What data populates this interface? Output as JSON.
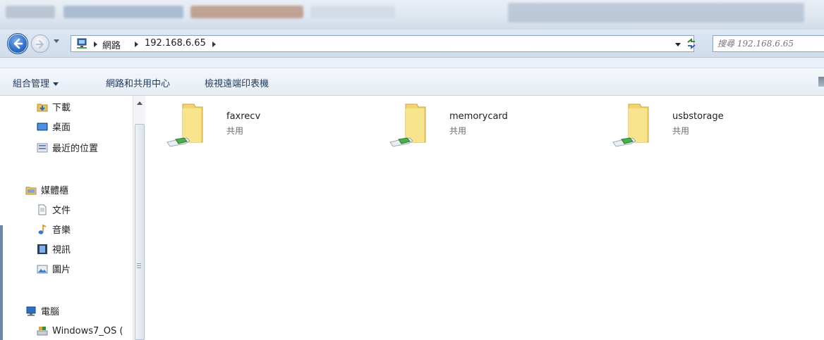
{
  "address_bar": {
    "breadcrumbs": [
      "網路",
      "192.168.6.65"
    ],
    "search_placeholder": "搜尋 192.168.6.65"
  },
  "command_bar": {
    "organize": "組合管理",
    "network_center": "網路和共用中心",
    "remote_printers": "檢視遠端印表機"
  },
  "nav_pane": {
    "items": [
      {
        "label": "下載",
        "icon": "downloads-icon"
      },
      {
        "label": "桌面",
        "icon": "desktop-icon"
      },
      {
        "label": "最近的位置",
        "icon": "recent-places-icon"
      },
      {
        "label": "媒體櫃",
        "icon": "libraries-icon",
        "group": true
      },
      {
        "label": "文件",
        "icon": "documents-icon"
      },
      {
        "label": "音樂",
        "icon": "music-icon"
      },
      {
        "label": "視訊",
        "icon": "videos-icon"
      },
      {
        "label": "圖片",
        "icon": "pictures-icon"
      },
      {
        "label": "電腦",
        "icon": "computer-icon",
        "group": true
      },
      {
        "label": "Windows7_OS (",
        "icon": "drive-icon"
      }
    ]
  },
  "shares": [
    {
      "name": "faxrecv",
      "type": "共用"
    },
    {
      "name": "memorycard",
      "type": "共用"
    },
    {
      "name": "usbstorage",
      "type": "共用"
    }
  ]
}
